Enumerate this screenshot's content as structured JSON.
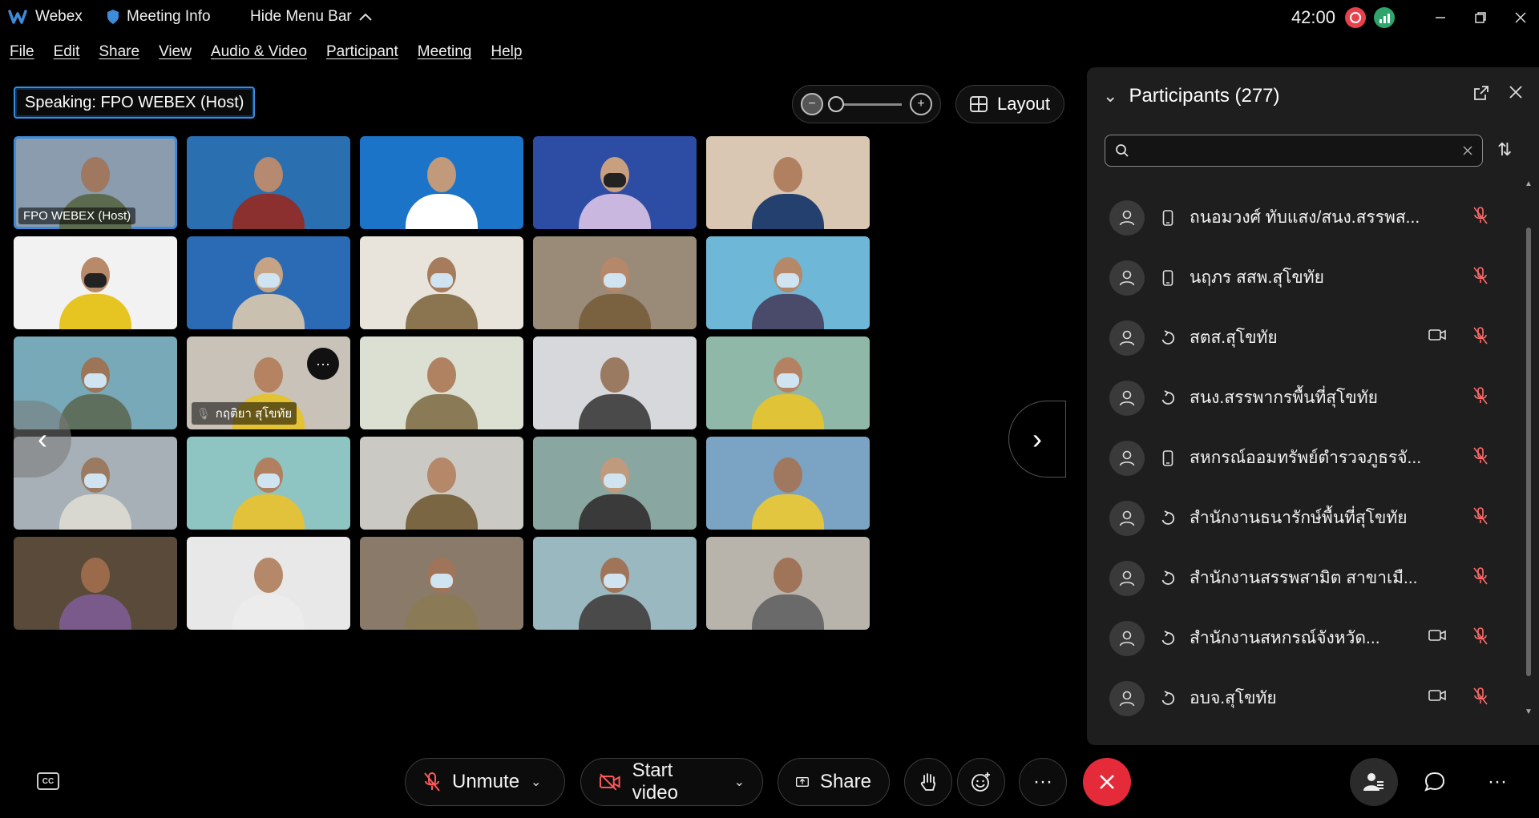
{
  "titlebar": {
    "app_name": "Webex",
    "meeting_info": "Meeting Info",
    "hide_menu": "Hide Menu Bar",
    "clock": "42:00"
  },
  "menu": [
    "File",
    "Edit",
    "Share",
    "View",
    "Audio & Video",
    "Participant",
    "Meeting",
    "Help"
  ],
  "speaking": {
    "prefix": "Speaking:",
    "name": "FPO WEBEX (Host)"
  },
  "layout_label": "Layout",
  "tiles": [
    {
      "label": "FPO WEBEX (Host)",
      "bg": "#8a9cad",
      "skin": "#a07860",
      "body": "#5c6b4f",
      "mask": false,
      "active": true
    },
    {
      "label": "",
      "bg": "#2a6fb0",
      "skin": "#b58a70",
      "body": "#8b2f2f",
      "mask": false
    },
    {
      "label": "",
      "bg": "#1c74c9",
      "skin": "#c09a7a",
      "body": "#ffffff",
      "mask": false
    },
    {
      "label": "",
      "bg": "#2d4ca3",
      "skin": "#c8a080",
      "body": "#c9b7e0",
      "mask": true
    },
    {
      "label": "",
      "bg": "#d9c7b3",
      "skin": "#b08060",
      "body": "#24406e",
      "mask": false
    },
    {
      "label": "",
      "bg": "#f2f2f2",
      "skin": "#b88a6a",
      "body": "#e6c422",
      "mask": true
    },
    {
      "label": "",
      "bg": "#2b6bb5",
      "skin": "#c6a385",
      "body": "#c9c0b0",
      "mask": true
    },
    {
      "label": "",
      "bg": "#e8e4dc",
      "skin": "#a67c5c",
      "body": "#8a7550",
      "mask": true
    },
    {
      "label": "",
      "bg": "#9a8a78",
      "skin": "#b48868",
      "body": "#7a6240",
      "mask": true
    },
    {
      "label": "",
      "bg": "#6fb7d6",
      "skin": "#b48868",
      "body": "#4a4a6a",
      "mask": true
    },
    {
      "label": "",
      "bg": "#78a9b8",
      "skin": "#9c7458",
      "body": "#5f6f5e",
      "mask": true
    },
    {
      "label": "กฤติยา สุโขทัย",
      "bg": "#c9c2b8",
      "skin": "#b58262",
      "body": "#e3c233",
      "mask": false,
      "more": true,
      "muted": true
    },
    {
      "label": "",
      "bg": "#dbe0d2",
      "skin": "#b08262",
      "body": "#8a7a55",
      "mask": false
    },
    {
      "label": "",
      "bg": "#d6d8dc",
      "skin": "#9a7a60",
      "body": "#4a4a4a",
      "mask": false
    },
    {
      "label": "",
      "bg": "#8fb8a8",
      "skin": "#b48262",
      "body": "#e0c336",
      "mask": true
    },
    {
      "label": "",
      "bg": "#a7b0b6",
      "skin": "#9a7a60",
      "body": "#d8d8d0",
      "mask": true
    },
    {
      "label": "",
      "bg": "#8ec4c2",
      "skin": "#b08060",
      "body": "#e2c23a",
      "mask": true
    },
    {
      "label": "",
      "bg": "#cbc9c3",
      "skin": "#b48868",
      "body": "#7a6642",
      "mask": false
    },
    {
      "label": "",
      "bg": "#8aa6a0",
      "skin": "#bf9a7c",
      "body": "#3a3a3a",
      "mask": true
    },
    {
      "label": "",
      "bg": "#7ba4c4",
      "skin": "#a07860",
      "body": "#e3c640",
      "mask": false
    },
    {
      "label": "",
      "bg": "#5a4a3a",
      "skin": "#9a6a4a",
      "body": "#7a5a8a",
      "mask": false
    },
    {
      "label": "",
      "bg": "#e8e8e8",
      "skin": "#b48868",
      "body": "#ececec",
      "mask": false
    },
    {
      "label": "",
      "bg": "#8a7a6a",
      "skin": "#a07458",
      "body": "#8a7a55",
      "mask": true
    },
    {
      "label": "",
      "bg": "#9ab8c0",
      "skin": "#a07458",
      "body": "#4a4a4a",
      "mask": true
    },
    {
      "label": "",
      "bg": "#b8b4ac",
      "skin": "#a07458",
      "body": "#6a6a6a",
      "mask": false
    }
  ],
  "participants": {
    "title": "Participants (277)",
    "search_placeholder": "",
    "list": [
      {
        "name": "ถนอมวงศ์ ทับแสง/สนง.สรรพส...",
        "device": "phone",
        "video": false
      },
      {
        "name": "นฤภร สสพ.สุโขทัย",
        "device": "phone",
        "video": false
      },
      {
        "name": "สตส.สุโขทัย",
        "device": "sync",
        "video": true
      },
      {
        "name": "สนง.สรรพากรพื้นที่สุโขทัย",
        "device": "sync",
        "video": false
      },
      {
        "name": "สหกรณ์ออมทรัพย์ตำรวจภูธรจั...",
        "device": "phone",
        "video": false
      },
      {
        "name": "สำนักงานธนารักษ์พื้นที่สุโขทัย",
        "device": "sync",
        "video": false
      },
      {
        "name": "สำนักงานสรรพสามิต สาขาเมื...",
        "device": "sync",
        "video": false
      },
      {
        "name": "สำนักงานสหกรณ์จังหวัด...",
        "device": "sync",
        "video": true
      },
      {
        "name": "อบจ.สุโขทัย",
        "device": "sync",
        "video": true
      }
    ]
  },
  "toolbar": {
    "unmute": "Unmute",
    "start_video": "Start video",
    "share": "Share",
    "cc": "CC"
  },
  "colors": {
    "accent": "#3d8bd9",
    "end_call": "#e52b39",
    "muted": "#ff5a5a"
  }
}
